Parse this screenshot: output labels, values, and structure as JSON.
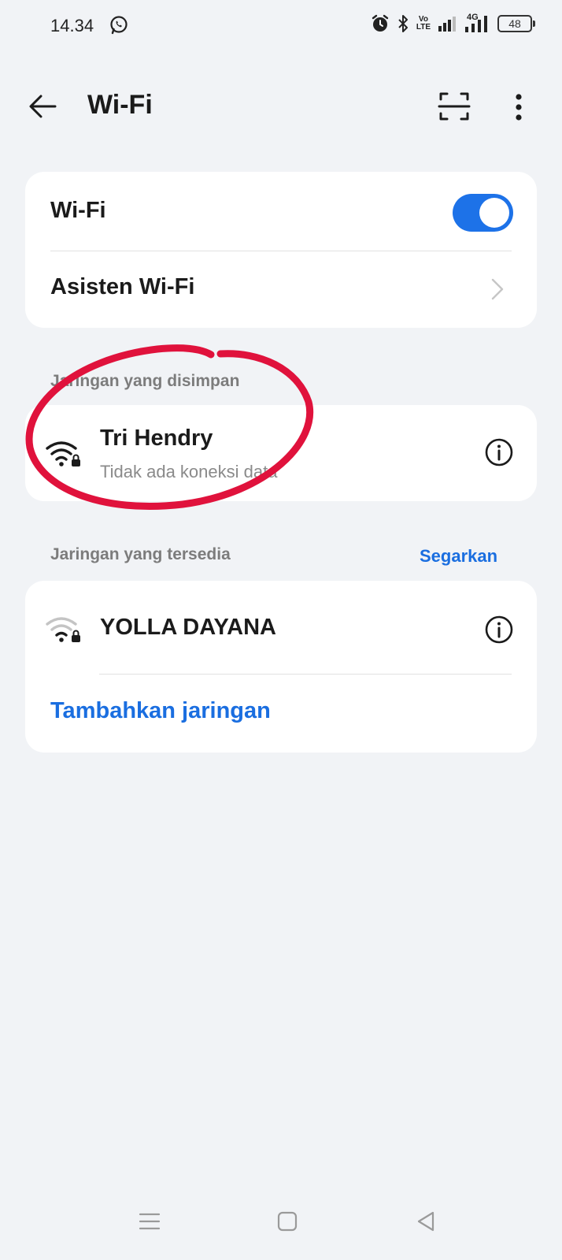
{
  "status_bar": {
    "time": "14.34",
    "volte_top": "Vo",
    "volte_bottom": "LTE",
    "network_type": "4G",
    "battery": "48",
    "icons": [
      "whatsapp-icon",
      "alarm-icon",
      "bluetooth-icon",
      "volte-icon",
      "signal-icon",
      "signal-4g-icon",
      "battery-icon"
    ]
  },
  "app_bar": {
    "title": "Wi-Fi",
    "icons": [
      "back-arrow-icon",
      "scan-icon",
      "more-vert-icon"
    ]
  },
  "wifi_card": {
    "wifi_label": "Wi-Fi",
    "wifi_enabled": true,
    "assistant_label": "Asisten Wi-Fi"
  },
  "saved_networks": {
    "section_label": "Jaringan yang disimpan",
    "items": [
      {
        "name": "Tri Hendry",
        "status": "Tidak ada koneksi data",
        "secured": true
      }
    ]
  },
  "available_networks": {
    "section_label": "Jaringan yang tersedia",
    "refresh_label": "Segarkan",
    "items": [
      {
        "name": "YOLLA DAYANA",
        "secured": true
      }
    ],
    "add_network_label": "Tambahkan jaringan"
  },
  "colors": {
    "accent": "#1d72e8",
    "link": "#1a6ee0",
    "annotation": "#e0123c",
    "background": "#f1f3f6"
  }
}
